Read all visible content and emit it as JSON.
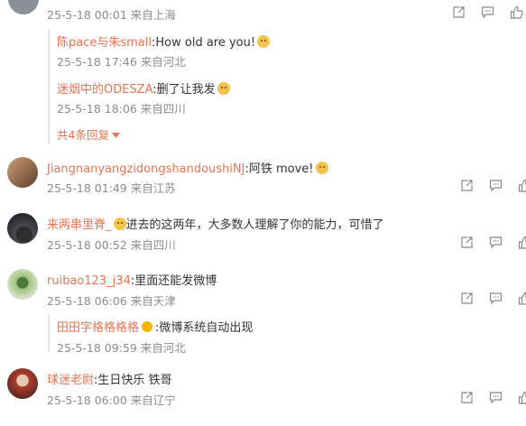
{
  "comments": [
    {
      "time": "25-5-18 00:01 来自上海"
    },
    {
      "user": "Jiangnanyangzidongshandoushi",
      "user_suffix": "NJ",
      "text": ":阿铁 move!",
      "time": "25-5-18 01:49 来自江苏"
    },
    {
      "user": "来两串里脊_",
      "text": "进去的这两年，大多数人理解了你的能力，可惜了",
      "time": "25-5-18 00:52 来自四川"
    },
    {
      "user": "ruibao123_j34",
      "text": ":里面还能发微博",
      "time": "25-5-18 06:06 来自天津"
    },
    {
      "user": "球迷老尉",
      "text": ":生日快乐 铁哥",
      "time": "25-5-18 06:00 来自辽宁"
    }
  ],
  "replies": [
    {
      "user": "陈pace与朱small",
      "text": ":How old are you!",
      "time": "25-5-18 17:46 来自河北"
    },
    {
      "user": "迷烟中的ODESZA",
      "text": ":删了让我发",
      "time": "25-5-18 18:06 来自四川"
    },
    {
      "user": "田田字格格格格",
      "text": ":微博系统自动出现",
      "time": "25-5-18 09:59 来自河北"
    }
  ],
  "more_replies": "共4条回复",
  "icons": [
    "share-icon",
    "comment-icon",
    "like-icon"
  ],
  "colors": {
    "username": "#eb7350",
    "meta": "#8c8c8c",
    "emoji": "#f5c24a"
  }
}
